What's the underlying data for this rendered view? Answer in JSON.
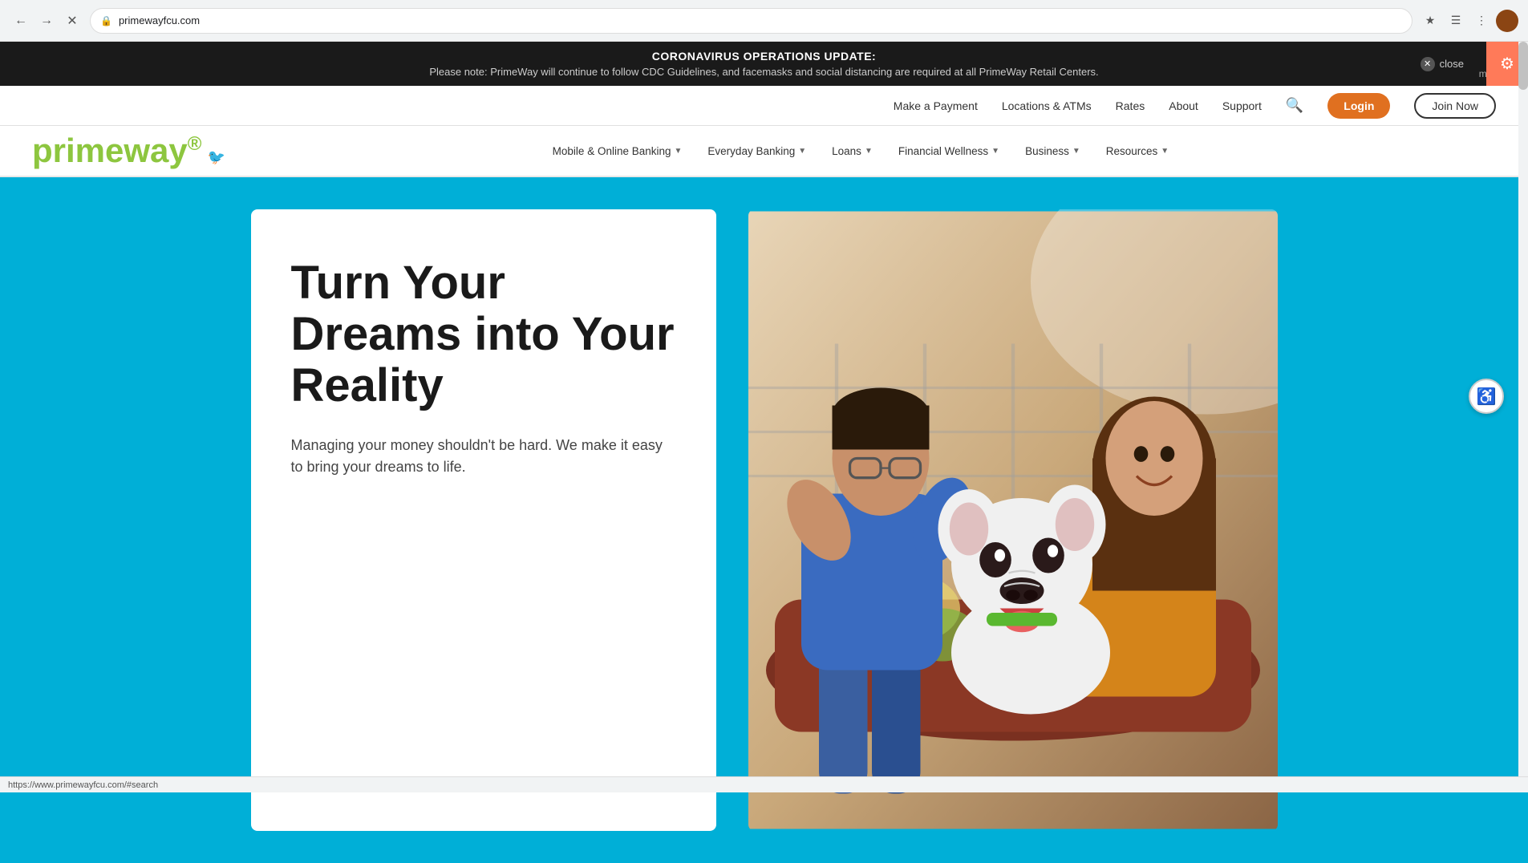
{
  "browser": {
    "url": "primewayfcu.com",
    "back_disabled": false,
    "forward_disabled": false
  },
  "alert": {
    "title": "CORONAVIRUS OPERATIONS UPDATE:",
    "body": "Please note: PrimeWay will continue to follow CDC Guidelines, and facemasks and social distancing are required at all PrimeWay Retail Centers.",
    "close_label": "close",
    "more_label": "more"
  },
  "top_nav": {
    "links": [
      {
        "label": "Make a Payment",
        "id": "make-payment"
      },
      {
        "label": "Locations & ATMs",
        "id": "locations-atms"
      },
      {
        "label": "Rates",
        "id": "rates"
      },
      {
        "label": "About",
        "id": "about"
      },
      {
        "label": "Support",
        "id": "support"
      }
    ],
    "login_label": "Login",
    "join_label": "Join Now"
  },
  "logo": {
    "text": "primeway",
    "trademark": "®"
  },
  "main_nav": {
    "items": [
      {
        "label": "Mobile & Online Banking",
        "has_dropdown": true
      },
      {
        "label": "Everyday Banking",
        "has_dropdown": true
      },
      {
        "label": "Loans",
        "has_dropdown": true
      },
      {
        "label": "Financial Wellness",
        "has_dropdown": true
      },
      {
        "label": "Business",
        "has_dropdown": true
      },
      {
        "label": "Resources",
        "has_dropdown": true
      }
    ]
  },
  "hero": {
    "title": "Turn Your Dreams into Your Reality",
    "subtitle": "Managing your money shouldn't be hard. We make it easy to bring your dreams to life.",
    "bg_color": "#00afd7"
  },
  "status_bar": {
    "url": "https://www.primewayfcu.com/#search"
  },
  "accessibility": {
    "label": "♿"
  }
}
